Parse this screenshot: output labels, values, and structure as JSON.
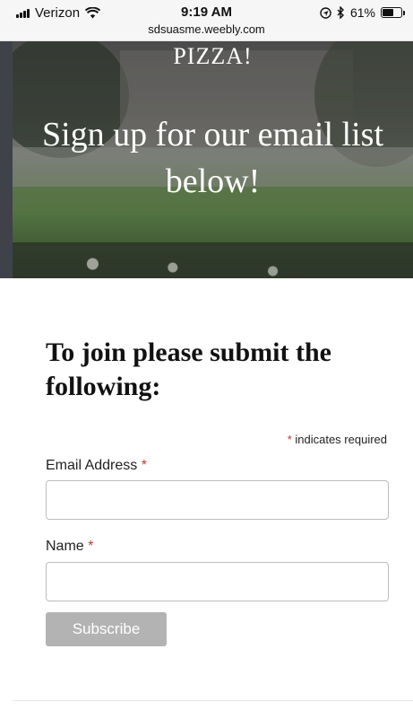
{
  "status_bar": {
    "carrier": "Verizon",
    "time": "9:19 AM",
    "url": "sdsuasme.weebly.com",
    "battery": "61%",
    "battery_level": 0.61
  },
  "hero": {
    "line_top": "PIZZA!",
    "headline": "Sign up for our email list below!"
  },
  "form": {
    "heading": "To join please submit the following:",
    "required_asterisk": "*",
    "required_note": "indicates required",
    "email_label": "Email Address",
    "email_value": "",
    "name_label": "Name",
    "name_value": "",
    "subscribe_label": "Subscribe"
  },
  "colors": {
    "required_asterisk": "#c0392b",
    "subscribe_button": "#b3b3b3"
  },
  "icons": [
    "signal-icon",
    "wifi-icon",
    "location-icon",
    "bluetooth-icon",
    "battery-icon"
  ]
}
